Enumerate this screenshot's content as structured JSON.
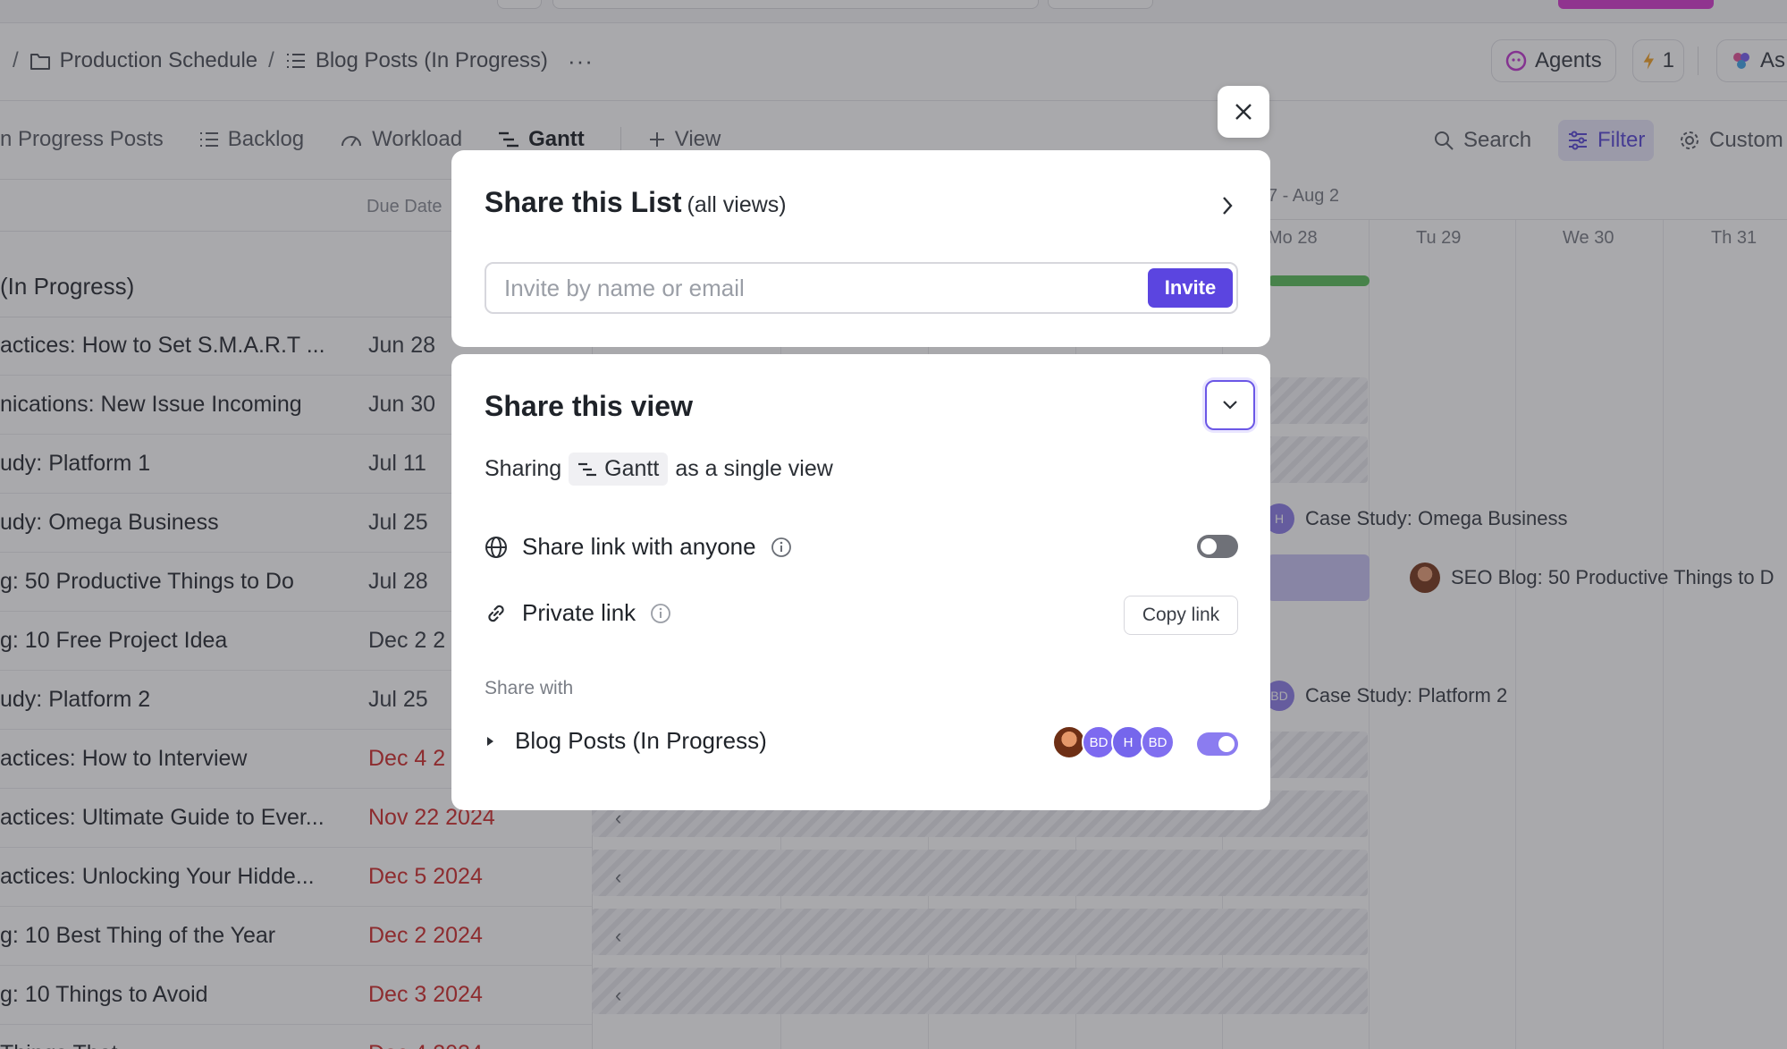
{
  "breadcrumb": {
    "separator": "/",
    "folder": "Production Schedule",
    "list": "Blog Posts (In Progress)",
    "more": "···"
  },
  "header": {
    "agents_label": "Agents",
    "bolt_count": "1",
    "ask_label": "As"
  },
  "tabs": {
    "items": [
      {
        "label": "n Progress Posts"
      },
      {
        "label": "Backlog"
      },
      {
        "label": "Workload"
      },
      {
        "label": "Gantt"
      }
    ],
    "add_view": "View",
    "search": "Search",
    "filter": "Filter",
    "customize": "Custom"
  },
  "list": {
    "due_date_header": "Due Date",
    "group_name": "(In Progress)",
    "rows": [
      {
        "name": "actices: How to Set S.M.A.R.T ...",
        "due": "Jun 28",
        "overdue": false
      },
      {
        "name": "nications: New Issue Incoming",
        "due": "Jun 30",
        "overdue": false
      },
      {
        "name": "udy: Platform 1",
        "due": "Jul 11",
        "overdue": false
      },
      {
        "name": "udy: Omega Business",
        "due": "Jul 25",
        "overdue": false
      },
      {
        "name": "g: 50 Productive Things to Do",
        "due": "Jul 28",
        "overdue": false
      },
      {
        "name": "g: 10 Free Project Idea",
        "due": "Dec 2 2",
        "overdue": false
      },
      {
        "name": "udy: Platform 2",
        "due": "Jul 25",
        "overdue": false
      },
      {
        "name": "actices: How to Interview",
        "due": "Dec 4 2",
        "overdue": true
      },
      {
        "name": "actices: Ultimate Guide to Ever...",
        "due": "Nov 22 2024",
        "overdue": true
      },
      {
        "name": "actices: Unlocking Your Hidde...",
        "due": "Dec 5 2024",
        "overdue": true
      },
      {
        "name": "g: 10 Best Thing of the Year",
        "due": "Dec 2 2024",
        "overdue": true
      },
      {
        "name": "g: 10 Things to Avoid",
        "due": "Dec 3 2024",
        "overdue": true
      },
      {
        "name": "Things That",
        "due": "Dec 4 2024",
        "overdue": true
      }
    ]
  },
  "gantt": {
    "week_label": "7 - Aug 2",
    "days": [
      "Mo  28",
      "Tu  29",
      "We  30",
      "Th  31"
    ],
    "bar_labels": {
      "omega": "Case Study: Omega Business",
      "seo": "SEO Blog: 50 Productive Things to D",
      "platform2": "Case Study: Platform 2"
    },
    "initials": {
      "h": "H",
      "bd": "BD"
    }
  },
  "modal": {
    "share_list": {
      "title": "Share this List",
      "subtitle": "(all views)",
      "invite_placeholder": "Invite by name or email",
      "invite_button": "Invite"
    },
    "share_view": {
      "title": "Share this view",
      "sharing_prefix": "Sharing",
      "view_name": "Gantt",
      "sharing_suffix": "as a single view",
      "share_link_label": "Share link with anyone",
      "share_link_enabled": false,
      "private_link_label": "Private link",
      "copy_link": "Copy link",
      "share_with_label": "Share with",
      "share_with_item": "Blog Posts (In Progress)",
      "share_with_enabled": true,
      "avatar_initials": [
        "BD",
        "H",
        "BD"
      ]
    }
  },
  "colors": {
    "accent": "#5b45e0",
    "overdue": "#d0302f",
    "toggle_on": "#8b7cf0",
    "gantt_progress": "#5cbf5c"
  }
}
